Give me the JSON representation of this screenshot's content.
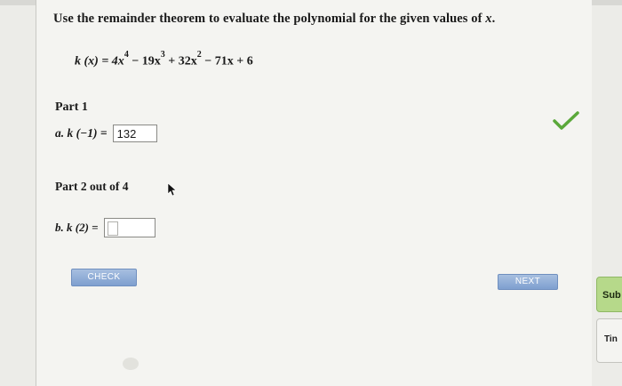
{
  "instruction": {
    "text_before": "Use the remainder theorem to evaluate the polynomial for the given values of ",
    "variable": "x",
    "text_after": "."
  },
  "polynomial": {
    "lhs": "k (x) = 4x",
    "exp1": "4",
    "t2": " − 19x",
    "exp2": "3",
    "t3": " + 32x",
    "exp3": "2",
    "t4": " − 71x + 6"
  },
  "part1": {
    "heading": "Part 1",
    "label": "a. k (−1) = ",
    "answer": "132"
  },
  "part2": {
    "heading": "Part 2 out of 4",
    "label": "b. k (2) = ",
    "answer": ""
  },
  "buttons": {
    "check": "CHECK",
    "next": "NEXT"
  },
  "side_tabs": {
    "submit": "Sub",
    "timer": "Tin"
  },
  "colors": {
    "correct_check": "#5aa83a",
    "button_blue": "#7e9fcf",
    "submit_green": "#b6d98a"
  }
}
